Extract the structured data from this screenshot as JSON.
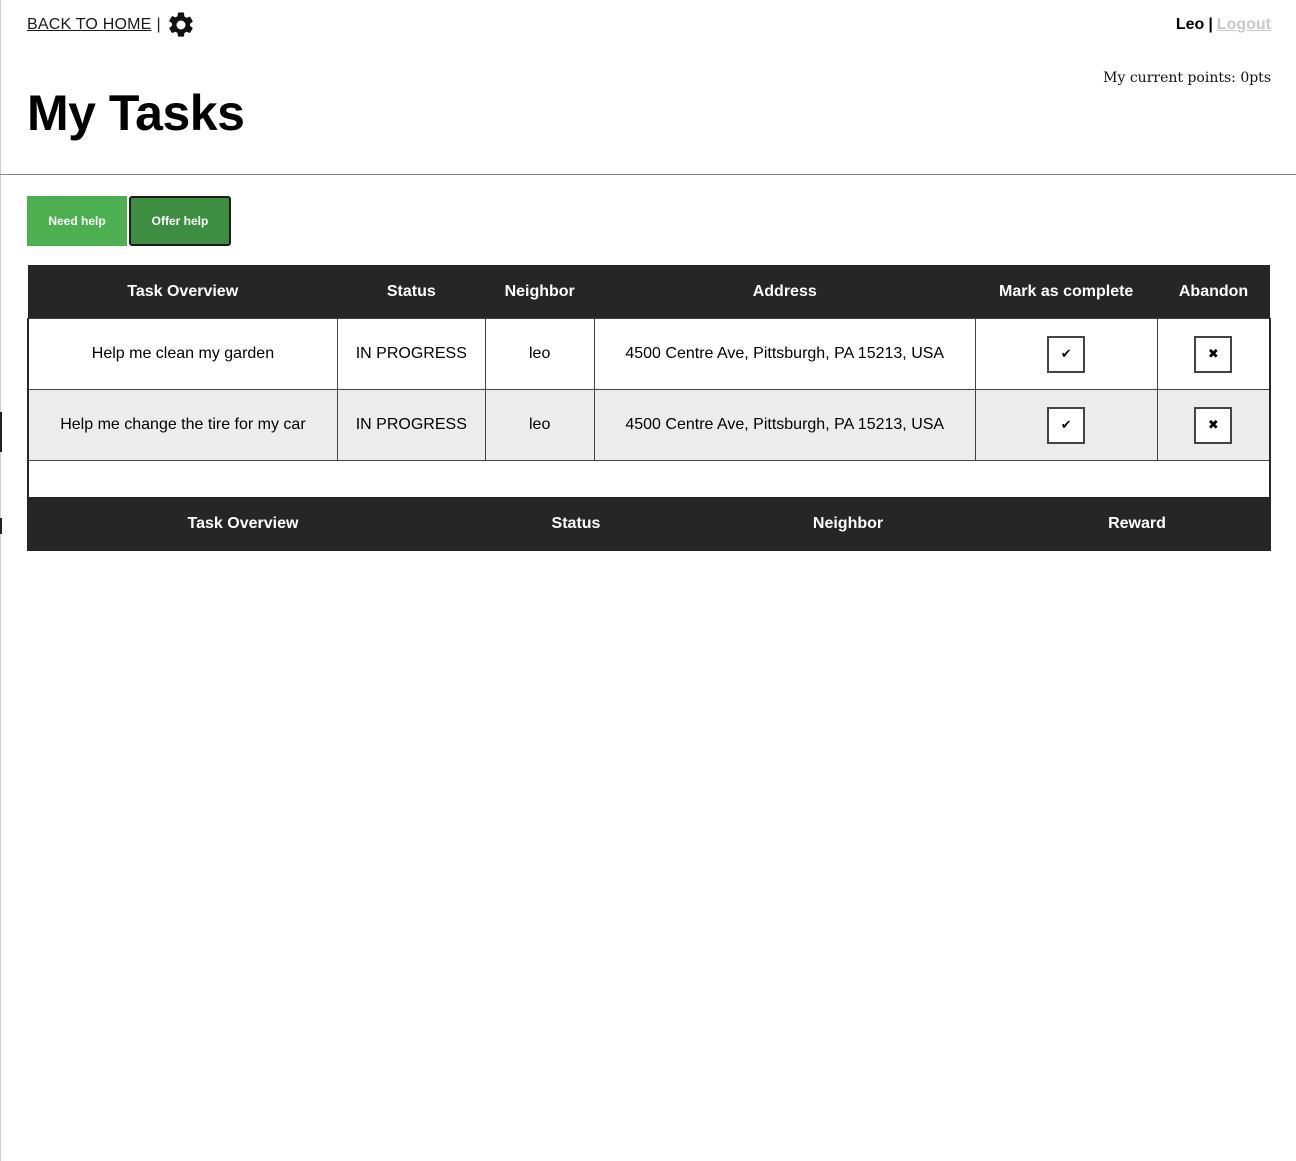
{
  "nav": {
    "back_label": "BACK TO HOME",
    "separator": "|",
    "settings_icon": "gear-icon",
    "user_name": "Leo",
    "user_separator": "|",
    "logout_label": "Logout"
  },
  "points_text": "My current points: 0pts",
  "page_title": "My Tasks",
  "toggle_buttons": {
    "need_help": "Need help",
    "offer_help": "Offer help"
  },
  "tasks_table": {
    "headers": [
      "Task Overview",
      "Status",
      "Neighbor",
      "Address",
      "Mark as complete",
      "Abandon"
    ],
    "rows": [
      {
        "overview": "Help me clean my garden",
        "status": "IN PROGRESS",
        "neighbor": "leo",
        "address": "4500 Centre Ave, Pittsburgh, PA 15213, USA",
        "complete_icon": "✔",
        "abandon_icon": "✖"
      },
      {
        "overview": "Help me change the tire for my car",
        "status": "IN PROGRESS",
        "neighbor": "leo",
        "address": "4500 Centre Ave, Pittsburgh, PA 15213, USA",
        "complete_icon": "✔",
        "abandon_icon": "✖"
      }
    ]
  },
  "second_table": {
    "headers": [
      "Task Overview",
      "Status",
      "Neighbor",
      "Reward"
    ]
  },
  "colors": {
    "header_bg": "#262626",
    "button_green": "#4caf50",
    "button_green_active": "#3e8e41",
    "alt_row": "#ececec",
    "logout_gray": "#c9c9c9"
  }
}
